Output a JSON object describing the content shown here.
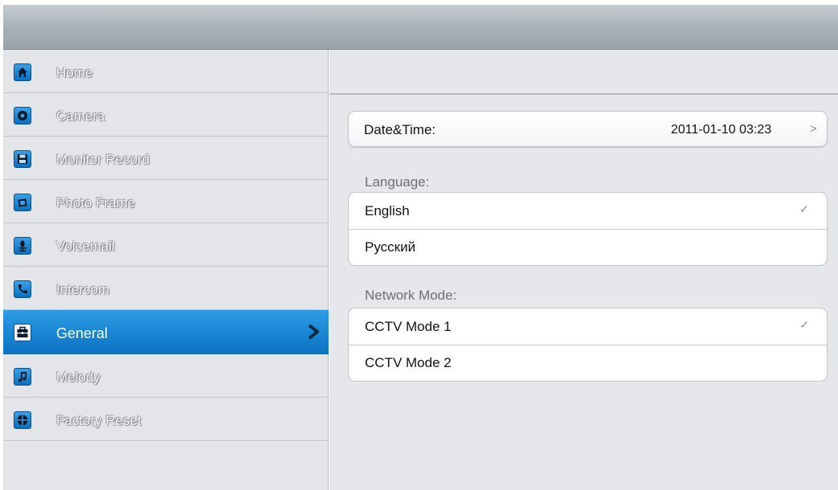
{
  "sidebar": {
    "items": [
      {
        "label": "Home",
        "icon": "home-icon"
      },
      {
        "label": "Camera",
        "icon": "camera-icon"
      },
      {
        "label": "Monitor Record",
        "icon": "floppy-disk-icon"
      },
      {
        "label": "Photo Frame",
        "icon": "photo-frame-icon"
      },
      {
        "label": "Voicemail",
        "icon": "microphone-icon"
      },
      {
        "label": "Intercom",
        "icon": "phone-icon"
      },
      {
        "label": "General",
        "icon": "toolbox-icon"
      },
      {
        "label": "Melody",
        "icon": "music-note-icon"
      },
      {
        "label": "Factory Reset",
        "icon": "reset-icon"
      }
    ],
    "active_index": 6
  },
  "datetime": {
    "label": "Date&Time:",
    "value": "2011-01-10  03:23",
    "arrow": ">"
  },
  "language": {
    "section_label": "Language:",
    "options": [
      {
        "label": "English",
        "selected": true
      },
      {
        "label": "Русский",
        "selected": false
      }
    ]
  },
  "network": {
    "section_label": "Network Mode:",
    "options": [
      {
        "label": "CCTV Mode 1",
        "selected": true
      },
      {
        "label": "CCTV Mode 2",
        "selected": false
      }
    ]
  },
  "colors": {
    "accent": "#1a86d4",
    "sidebar_bg": "#e4e5e8",
    "main_bg": "#e6e7ea"
  }
}
